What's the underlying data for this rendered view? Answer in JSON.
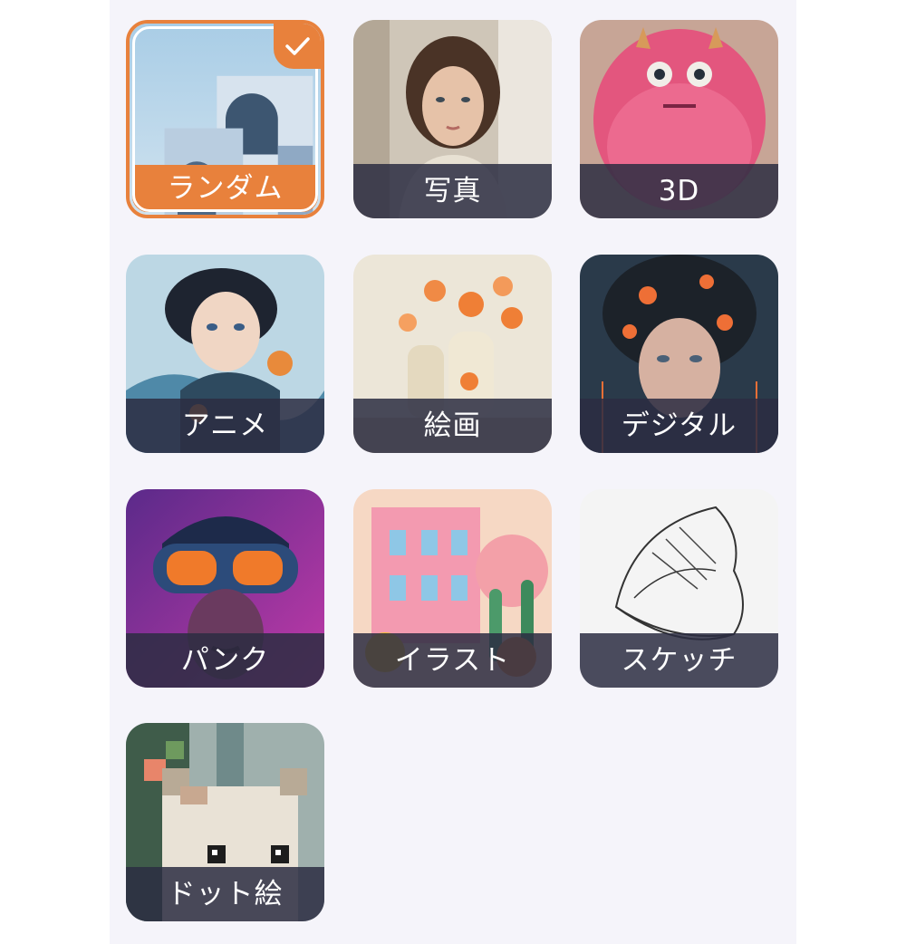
{
  "styles": [
    {
      "label": "ランダム",
      "selected": true,
      "icon": "architecture-image"
    },
    {
      "label": "写真",
      "selected": false,
      "icon": "portrait-photo-image"
    },
    {
      "label": "3D",
      "selected": false,
      "icon": "pink-monster-image"
    },
    {
      "label": "アニメ",
      "selected": false,
      "icon": "anime-boy-image"
    },
    {
      "label": "絵画",
      "selected": false,
      "icon": "still-life-painting-image"
    },
    {
      "label": "デジタル",
      "selected": false,
      "icon": "cyborg-girl-image"
    },
    {
      "label": "パンク",
      "selected": false,
      "icon": "cyberpunk-goggles-image"
    },
    {
      "label": "イラスト",
      "selected": false,
      "icon": "pink-house-illustration-image"
    },
    {
      "label": "スケッチ",
      "selected": false,
      "icon": "sneaker-sketch-image"
    },
    {
      "label": "ドット絵",
      "selected": false,
      "icon": "pixel-cat-image"
    }
  ],
  "colors": {
    "accent": "#e8813c",
    "label_bg": "#2b2d42",
    "panel_bg": "#f5f4fa"
  },
  "selected_icon": "checkmark-icon"
}
